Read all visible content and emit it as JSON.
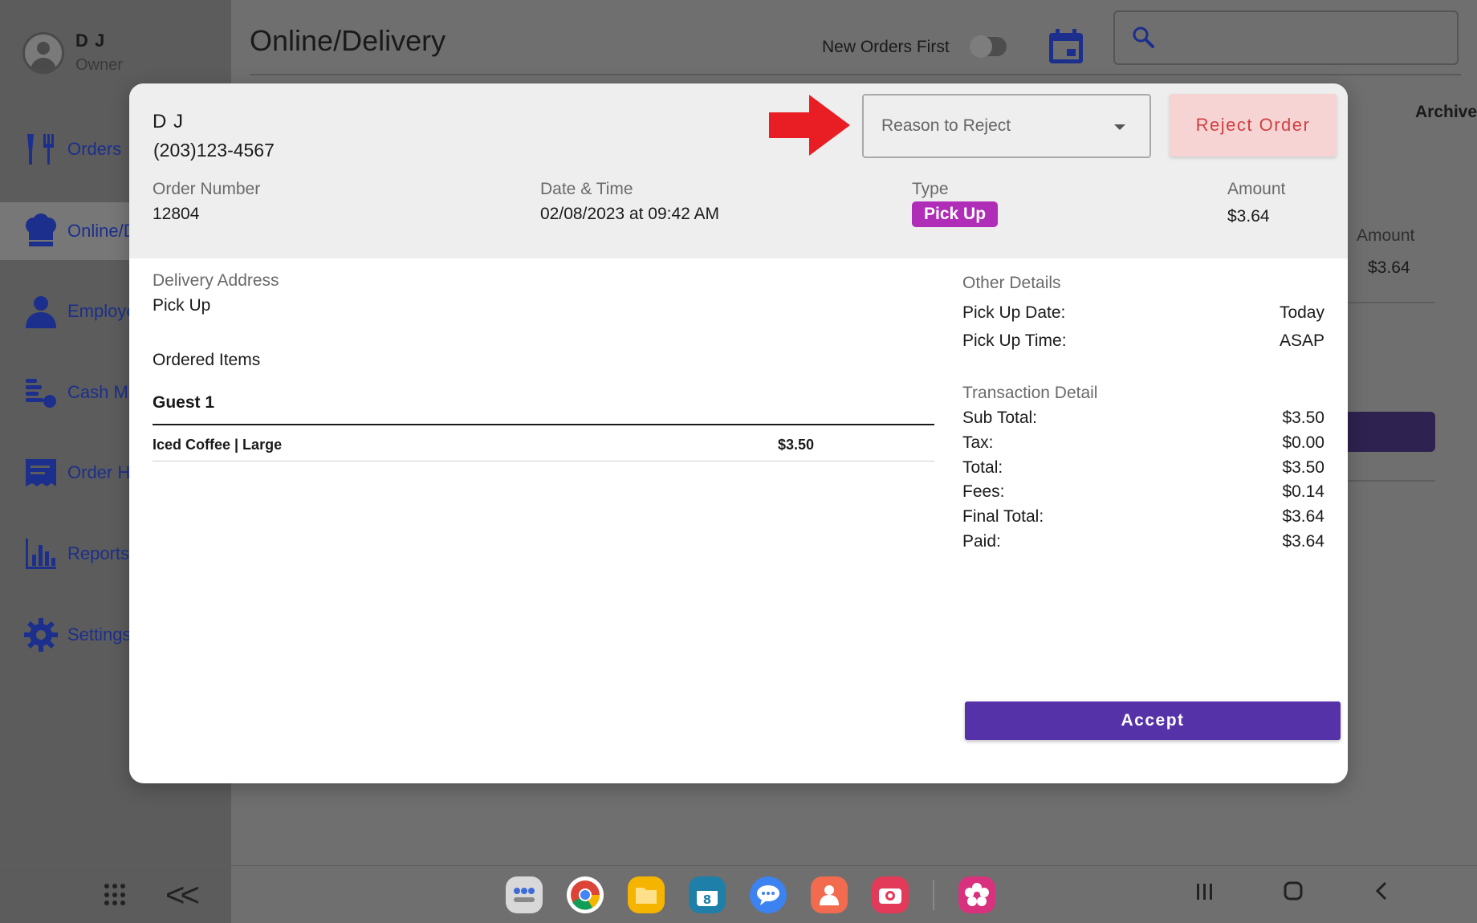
{
  "user": {
    "name": "D J",
    "role": "Owner"
  },
  "sidebar": {
    "items": [
      {
        "label": "Orders"
      },
      {
        "label": "Online/D"
      },
      {
        "label": "Employe"
      },
      {
        "label": "Cash M"
      },
      {
        "label": "Order H"
      },
      {
        "label": "Reports"
      },
      {
        "label": "Settings"
      }
    ]
  },
  "header": {
    "title": "Online/Delivery",
    "toggle_label": "New Orders First",
    "search_placeholder": ""
  },
  "background": {
    "archive_tab": "Archive",
    "amount_label": "Amount",
    "amount_value": "$3.64"
  },
  "modal": {
    "customer_name": "D J",
    "customer_phone": "(203)123-4567",
    "reject_select_placeholder": "Reason to Reject",
    "reject_button": "Reject Order",
    "order_number_label": "Order Number",
    "order_number": "12804",
    "datetime_label": "Date & Time",
    "datetime": "02/08/2023 at 09:42 AM",
    "type_label": "Type",
    "type": "Pick Up",
    "amount_label": "Amount",
    "amount": "$3.64",
    "delivery_address_label": "Delivery Address",
    "delivery_address": "Pick Up",
    "ordered_items_label": "Ordered Items",
    "guest": "Guest 1",
    "items": [
      {
        "name": "Iced Coffee | Large",
        "price": "$3.50"
      }
    ],
    "other_details_label": "Other Details",
    "other_details": [
      {
        "label": "Pick Up Date:",
        "value": "Today"
      },
      {
        "label": "Pick Up Time:",
        "value": "ASAP"
      }
    ],
    "transaction_label": "Transaction Detail",
    "transaction": [
      {
        "label": "Sub Total:",
        "value": "$3.50"
      },
      {
        "label": "Tax:",
        "value": "$0.00"
      },
      {
        "label": "Total:",
        "value": "$3.50"
      },
      {
        "label": "Fees:",
        "value": "$0.14"
      },
      {
        "label": "Final Total:",
        "value": "$3.64"
      },
      {
        "label": "Paid:",
        "value": "$3.64"
      }
    ],
    "accept_button": "Accept"
  },
  "colors": {
    "accent": "#5632a8",
    "type_badge": "#b02db8",
    "reject": "#d24040",
    "arrow": "#e81e24"
  },
  "taskbar": {
    "apps": [
      "launcher-app",
      "chrome-app",
      "files-app",
      "calendar-app",
      "messages-app",
      "contacts-app",
      "camera-app",
      "gallery-app"
    ]
  }
}
